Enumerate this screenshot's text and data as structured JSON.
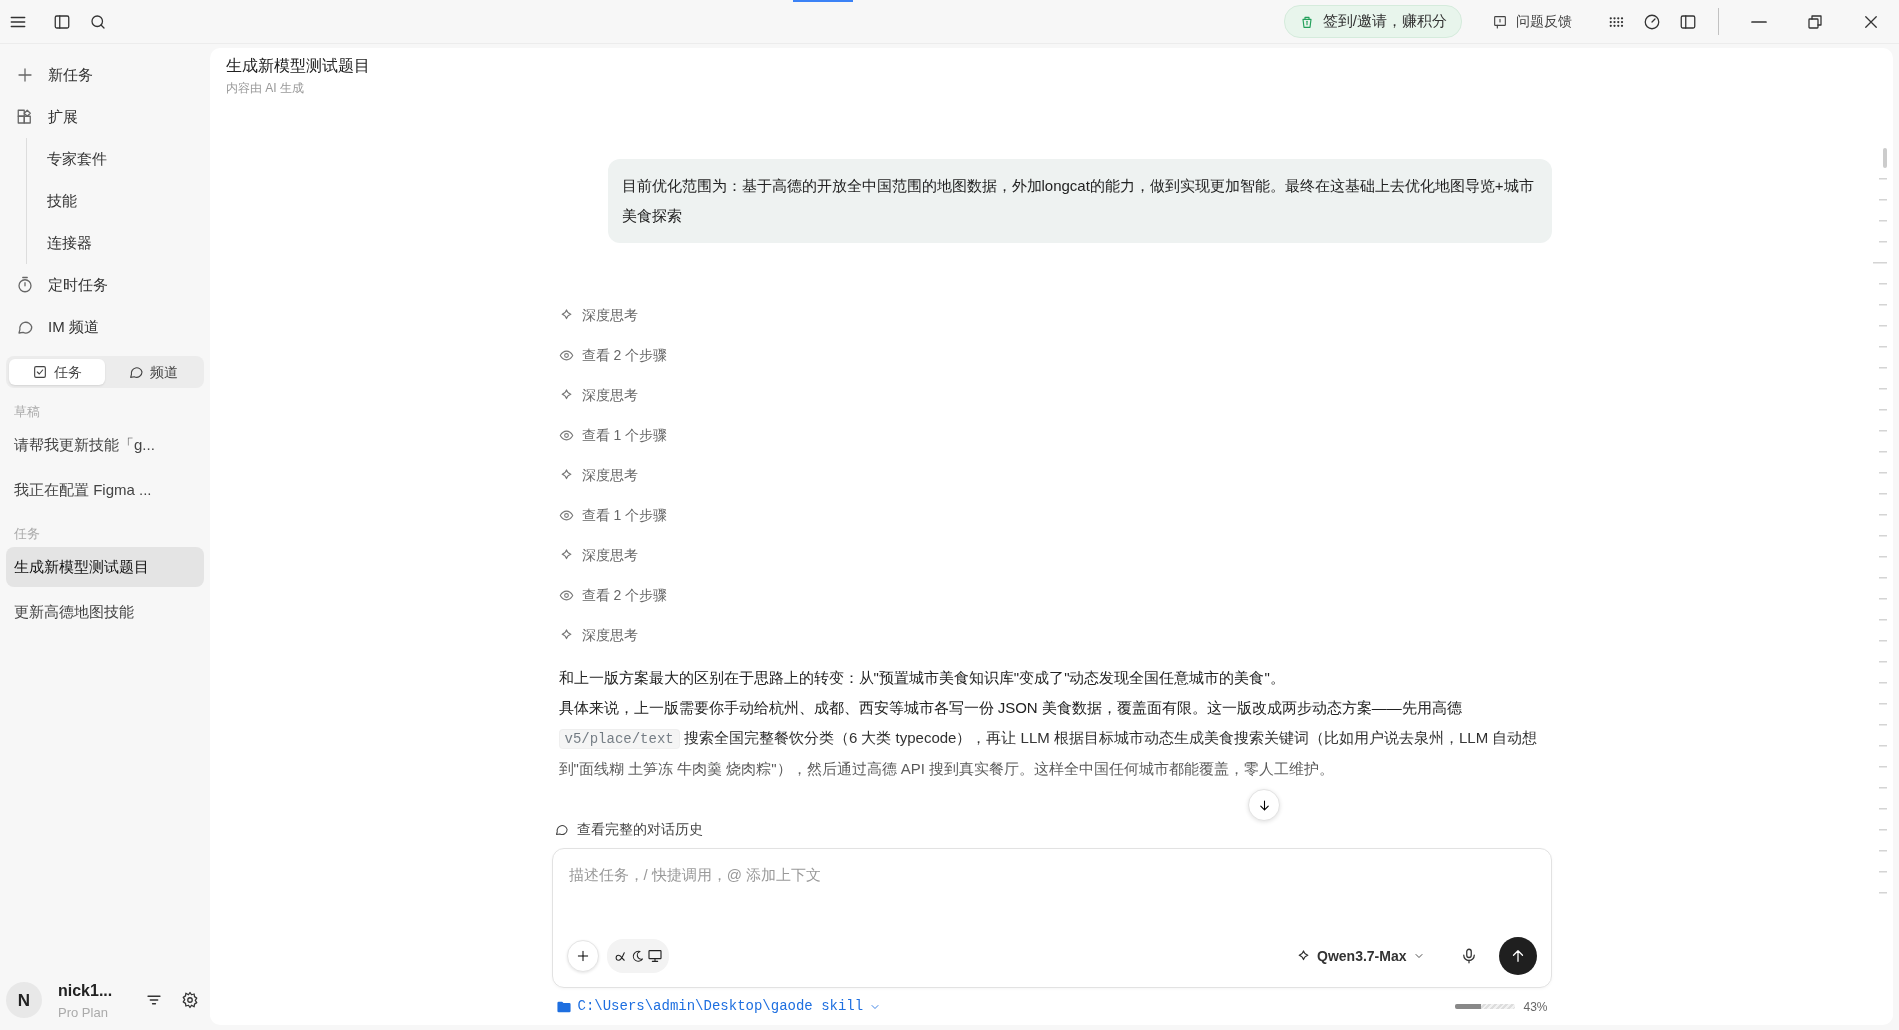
{
  "topbar": {
    "checkin": "签到/邀请，赚积分",
    "feedback": "问题反馈"
  },
  "sidebar": {
    "nav": [
      {
        "kind": "new",
        "label": "新任务"
      },
      {
        "kind": "extend",
        "label": "扩展",
        "expanded": true,
        "children": [
          {
            "label": "专家套件"
          },
          {
            "label": "技能"
          },
          {
            "label": "连接器"
          }
        ]
      },
      {
        "kind": "timer",
        "label": "定时任务"
      },
      {
        "kind": "chat",
        "label": "IM 频道"
      }
    ],
    "tabs": [
      {
        "kind": "task",
        "label": "任务",
        "selected": true
      },
      {
        "kind": "channel",
        "label": "频道",
        "selected": false
      }
    ],
    "sections": [
      {
        "heading": "草稿",
        "items": [
          {
            "label": "请帮我更新技能「g...",
            "selected": false
          },
          {
            "label": "我正在配置 Figma ...",
            "selected": false
          }
        ]
      },
      {
        "heading": "任务",
        "items": [
          {
            "label": "生成新模型测试题目",
            "selected": true
          },
          {
            "label": "更新高德地图技能",
            "selected": false
          }
        ]
      }
    ],
    "user": {
      "avatar": "N",
      "name": "nick1...",
      "plan": "Pro Plan"
    }
  },
  "conversation": {
    "title": "生成新模型测试题目",
    "subtitle": "内容由 AI 生成",
    "user_message": "目前优化范围为：基于高德的开放全中国范围的地图数据，外加longcat的能力，做到实现更加智能。最终在这基础上去优化地图导览+城市美食探索",
    "steps": [
      {
        "kind": "thinking",
        "label": "深度思考"
      },
      {
        "kind": "view",
        "label": "查看 2 个步骤"
      },
      {
        "kind": "thinking",
        "label": "深度思考"
      },
      {
        "kind": "view",
        "label": "查看 1 个步骤"
      },
      {
        "kind": "thinking",
        "label": "深度思考"
      },
      {
        "kind": "view",
        "label": "查看 1 个步骤"
      },
      {
        "kind": "thinking",
        "label": "深度思考"
      },
      {
        "kind": "view",
        "label": "查看 2 个步骤"
      },
      {
        "kind": "thinking",
        "label": "深度思考"
      }
    ],
    "answer": [
      [
        {
          "kind": "text",
          "text": "和上一版方案最大的区别在于思路上的转变：从\"预置城市美食知识库\"变成了\"动态发现全国任意城市的美食\"。"
        }
      ],
      [
        {
          "kind": "text",
          "text": "具体来说，上一版需要你手动给杭州、成都、西安等城市各写一份 JSON 美食数据，覆盖面有限。这一版改成两步动态方案——先用高德 "
        },
        {
          "kind": "code",
          "text": "v5/place/text"
        },
        {
          "kind": "text",
          "text": " 搜索全国完整餐饮分类（6 大类 typecode），再让 LLM 根据目标城市动态生成美食搜索关键词（比如用户说去泉州，LLM 自动想到\"面线糊 土笋冻 牛肉羹 烧肉粽\"），然后通过高德 API 搜到真实餐厅。这样全中国任何城市都能覆盖，零人工维护。"
        }
      ]
    ],
    "history_link": "查看完整的对话历史"
  },
  "composer": {
    "placeholder": "描述任务，/ 快捷调用，@ 添加上下文",
    "model": "Qwen3.7-Max",
    "path": "C:\\Users\\admin\\Desktop\\gaode skill",
    "context": {
      "level": 0.43,
      "reading": "43%"
    }
  }
}
